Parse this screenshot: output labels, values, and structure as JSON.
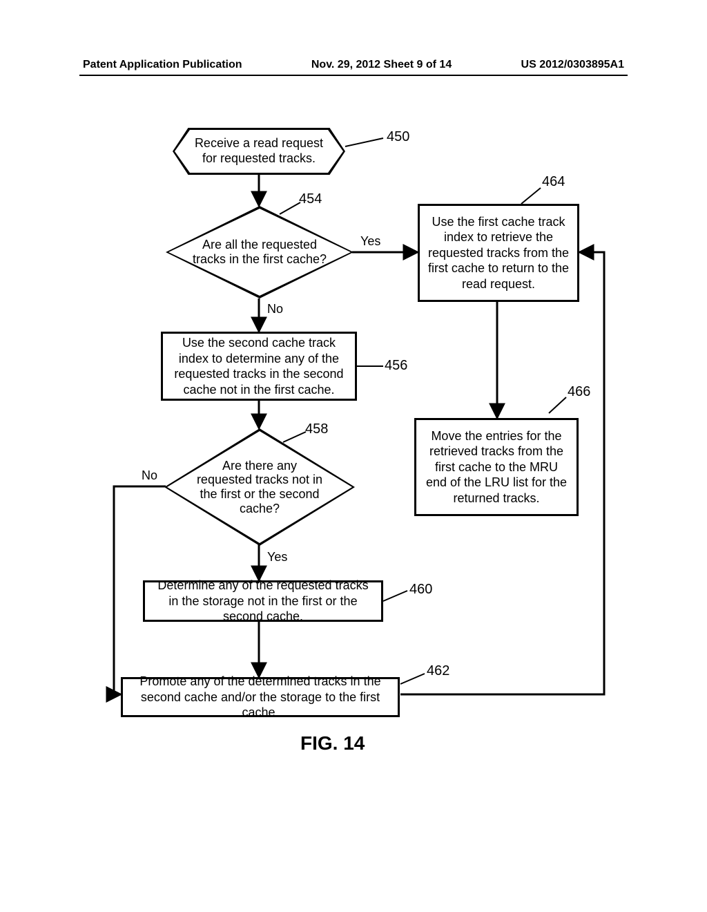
{
  "header": {
    "left": "Patent Application Publication",
    "center": "Nov. 29, 2012  Sheet 9 of 14",
    "right": "US 2012/0303895A1"
  },
  "nodes": {
    "n450": "Receive a read request for requested tracks.",
    "n454": "Are all the requested tracks in the first cache?",
    "n456": "Use the second cache track index to determine any of the requested tracks in the second cache not in the first cache.",
    "n458": "Are there any requested tracks not in the first or the second cache?",
    "n460": "Determine any of the requested tracks in the storage not in the first or the second cache.",
    "n462": "Promote any of the determined tracks in the second cache and/or the storage to the first cache.",
    "n464": "Use the first cache track index to retrieve the requested tracks from the first cache to return to the read request.",
    "n466": "Move the entries for the retrieved tracks from the first cache to the MRU end of the LRU list for the returned tracks."
  },
  "refs": {
    "r450": "450",
    "r454": "454",
    "r456": "456",
    "r458": "458",
    "r460": "460",
    "r462": "462",
    "r464": "464",
    "r466": "466"
  },
  "edges": {
    "yes454": "Yes",
    "no454": "No",
    "yes458": "Yes",
    "no458": "No"
  },
  "caption": "FIG. 14"
}
